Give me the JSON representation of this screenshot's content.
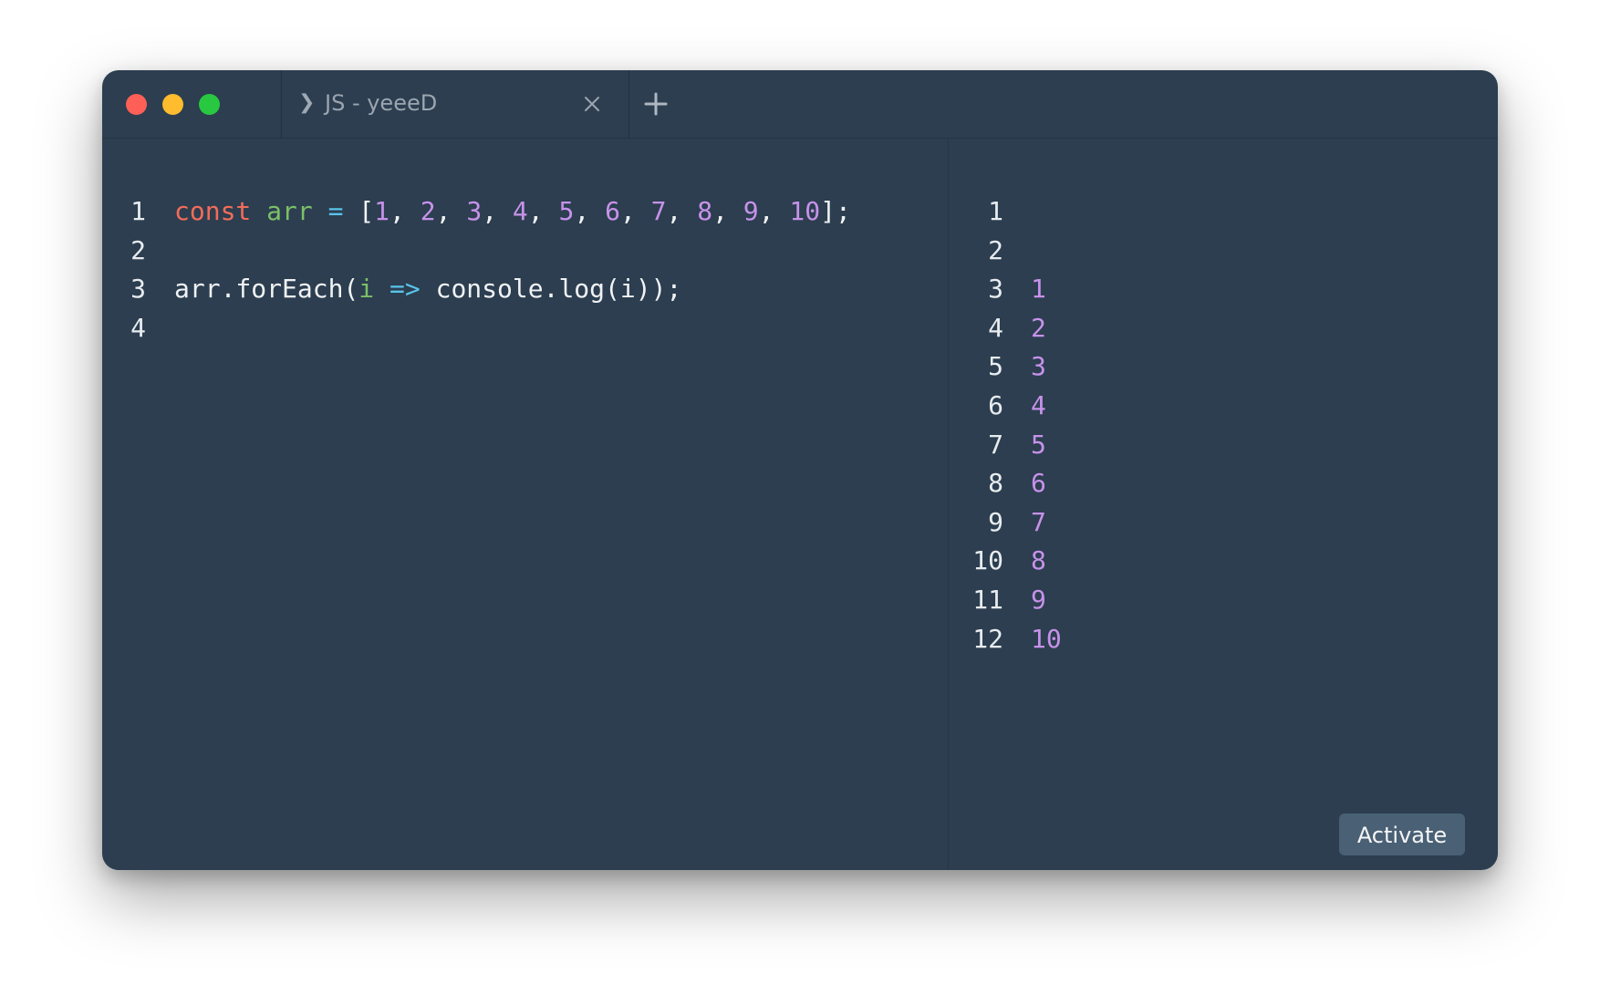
{
  "tab": {
    "title": "JS - yeeeD",
    "chevron": "❯"
  },
  "editor": {
    "lines": [
      {
        "number": "1",
        "tokens": [
          {
            "t": "const",
            "c": "kw"
          },
          {
            "t": " ",
            "c": "punc"
          },
          {
            "t": "arr",
            "c": "var"
          },
          {
            "t": " ",
            "c": "punc"
          },
          {
            "t": "=",
            "c": "op"
          },
          {
            "t": " [",
            "c": "punc"
          },
          {
            "t": "1",
            "c": "num"
          },
          {
            "t": ", ",
            "c": "punc"
          },
          {
            "t": "2",
            "c": "num"
          },
          {
            "t": ", ",
            "c": "punc"
          },
          {
            "t": "3",
            "c": "num"
          },
          {
            "t": ", ",
            "c": "punc"
          },
          {
            "t": "4",
            "c": "num"
          },
          {
            "t": ", ",
            "c": "punc"
          },
          {
            "t": "5",
            "c": "num"
          },
          {
            "t": ", ",
            "c": "punc"
          },
          {
            "t": "6",
            "c": "num"
          },
          {
            "t": ", ",
            "c": "punc"
          },
          {
            "t": "7",
            "c": "num"
          },
          {
            "t": ", ",
            "c": "punc"
          },
          {
            "t": "8",
            "c": "num"
          },
          {
            "t": ", ",
            "c": "punc"
          },
          {
            "t": "9",
            "c": "num"
          },
          {
            "t": ", ",
            "c": "punc"
          },
          {
            "t": "10",
            "c": "num"
          },
          {
            "t": "];",
            "c": "punc"
          }
        ]
      },
      {
        "number": "2",
        "tokens": []
      },
      {
        "number": "3",
        "tokens": [
          {
            "t": "arr.forEach(",
            "c": "punc"
          },
          {
            "t": "i",
            "c": "var"
          },
          {
            "t": " ",
            "c": "punc"
          },
          {
            "t": "=>",
            "c": "op"
          },
          {
            "t": " console.log(i));",
            "c": "punc"
          }
        ]
      },
      {
        "number": "4",
        "tokens": []
      }
    ]
  },
  "output": {
    "lines": [
      {
        "number": "1",
        "value": ""
      },
      {
        "number": "2",
        "value": ""
      },
      {
        "number": "3",
        "value": "1"
      },
      {
        "number": "4",
        "value": "2"
      },
      {
        "number": "5",
        "value": "3"
      },
      {
        "number": "6",
        "value": "4"
      },
      {
        "number": "7",
        "value": "5"
      },
      {
        "number": "8",
        "value": "6"
      },
      {
        "number": "9",
        "value": "7"
      },
      {
        "number": "10",
        "value": "8"
      },
      {
        "number": "11",
        "value": "9"
      },
      {
        "number": "12",
        "value": "10"
      }
    ]
  },
  "activate_label": "Activate",
  "colors": {
    "background": "#2c3e50",
    "keyword": "#f36c5a",
    "variable": "#7cc067",
    "operator": "#59c3e8",
    "number": "#c792ea"
  }
}
